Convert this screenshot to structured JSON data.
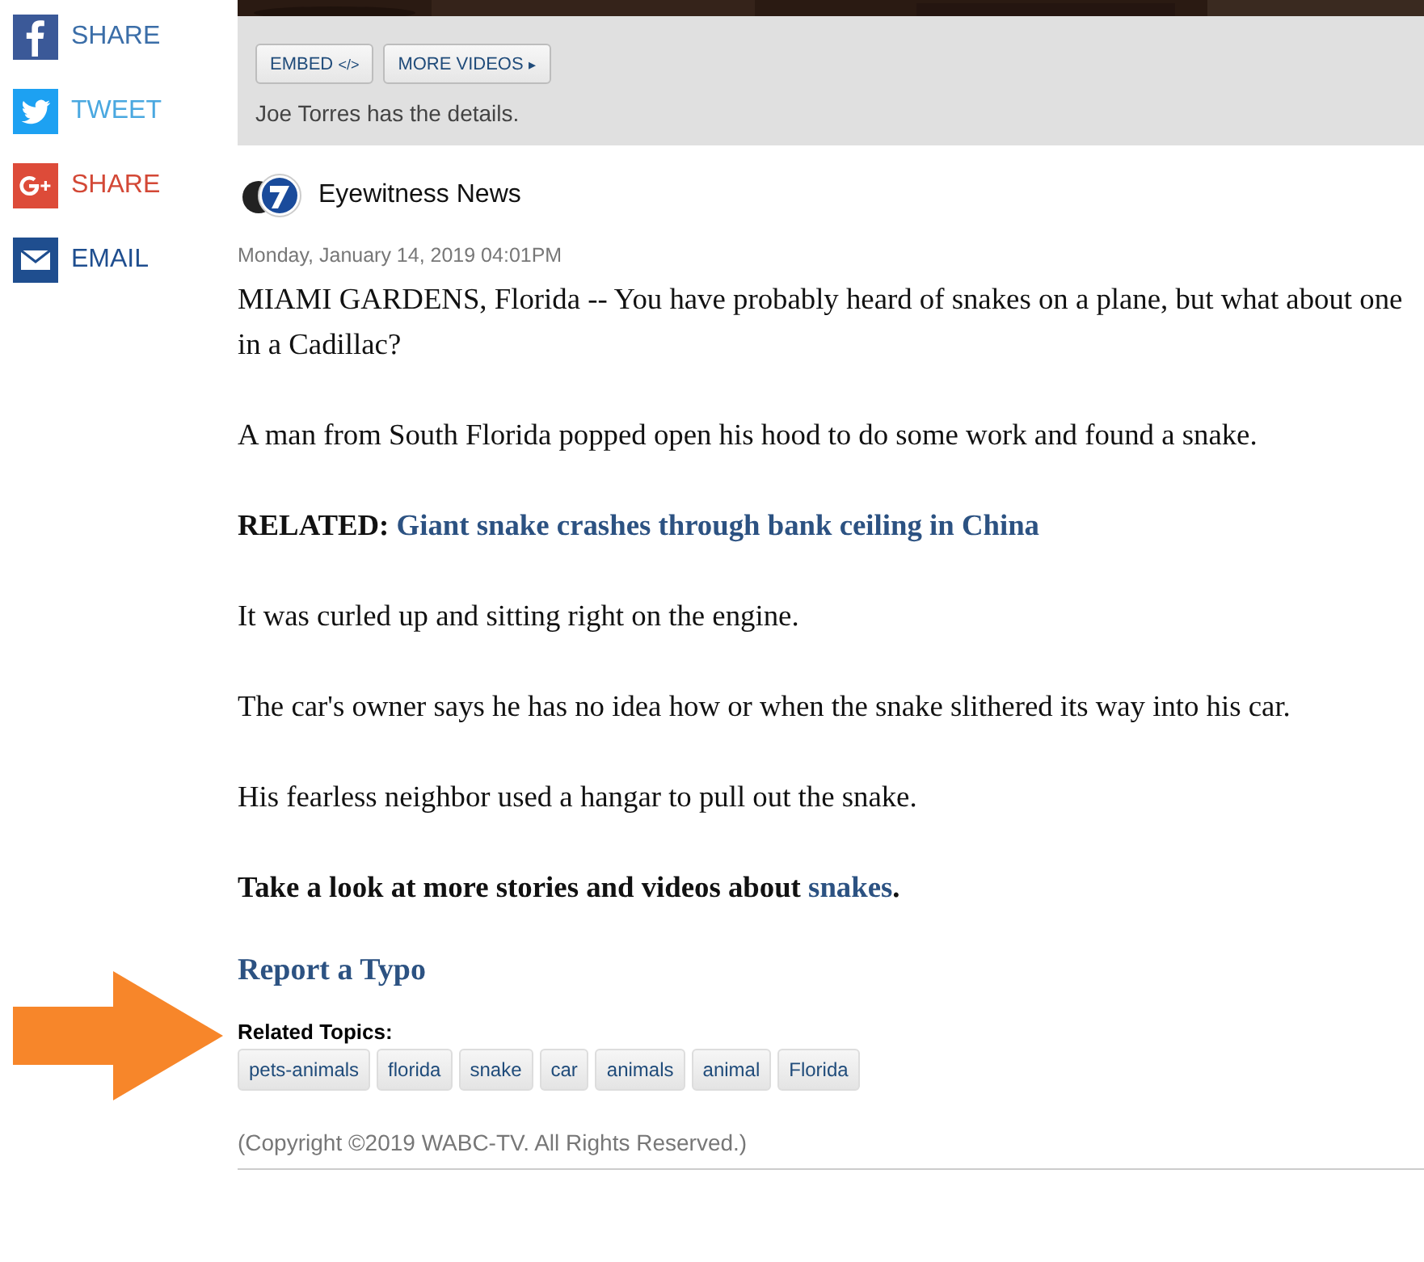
{
  "share_buttons": [
    {
      "kind": "facebook",
      "label": "SHARE"
    },
    {
      "kind": "twitter",
      "label": "TWEET"
    },
    {
      "kind": "googleplus",
      "label": "SHARE"
    },
    {
      "kind": "email",
      "label": "EMAIL"
    }
  ],
  "video": {
    "buttons": [
      {
        "label": "EMBED",
        "code": "</>"
      },
      {
        "label": "MORE VIDEOS",
        "code": "▸"
      }
    ],
    "caption": "Joe Torres has the details."
  },
  "source": {
    "name": "Eyewitness News"
  },
  "timestamp": "Monday, January 14, 2019 04:01PM",
  "paragraphs": [
    {
      "kind": "text",
      "text": "MIAMI GARDENS, Florida -- You have probably heard of snakes on a plane, but what about one in a Cadillac?"
    },
    {
      "kind": "text",
      "text": "A man from South Florida popped open his hood to do some work and found a snake."
    },
    {
      "kind": "related",
      "label": "RELATED:",
      "link": "Giant snake crashes through bank ceiling in China"
    },
    {
      "kind": "text",
      "text": "It was curled up and sitting right on the engine."
    },
    {
      "kind": "text",
      "text": "The car's owner says he has no idea how or when the snake slithered its way into his car."
    },
    {
      "kind": "text",
      "text": "His fearless neighbor used a hangar to pull out the snake."
    },
    {
      "kind": "more",
      "text": "Take a look at more stories and videos about",
      "link": "snakes",
      "tail": "."
    }
  ],
  "report_link": "Report a Typo",
  "related_topics": {
    "title": "Related Topics:",
    "tags": [
      "pets-animals",
      "florida",
      "snake",
      "car",
      "animals",
      "animal",
      "Florida"
    ]
  },
  "copyright": "(Copyright ©2019 WABC-TV. All Rights Reserved.)"
}
